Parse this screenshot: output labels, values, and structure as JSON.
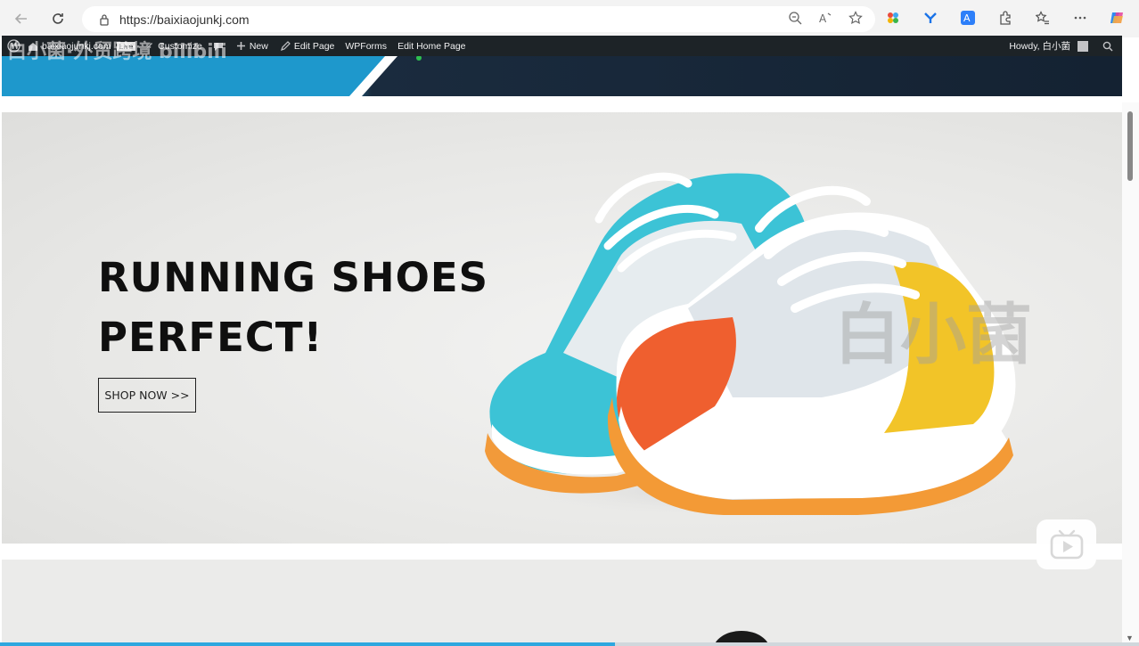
{
  "browser": {
    "url": "https://baixiaojunkj.com"
  },
  "wp_admin": {
    "site_name": "baixiaojunkj.com",
    "live_badge": "Live",
    "customize": "Customize",
    "new": "New",
    "edit_page": "Edit Page",
    "wpforms": "WPForms",
    "edit_home_page": "Edit Home Page",
    "howdy": "Howdy, 白小菌"
  },
  "hero": {
    "title_line1": "RUNNING SHOES",
    "title_line2": "PERFECT!",
    "cta_label": "SHOP NOW >>"
  },
  "overlay": {
    "watermark_text": "白小菌",
    "bili_text": "白小菌·外贸跨境 bilibili"
  },
  "playback": {
    "progress_percent": 54
  },
  "colors": {
    "wp_bar": "#1d2327",
    "header_blue": "#1b9ed0",
    "progress": "#2ea7df"
  }
}
